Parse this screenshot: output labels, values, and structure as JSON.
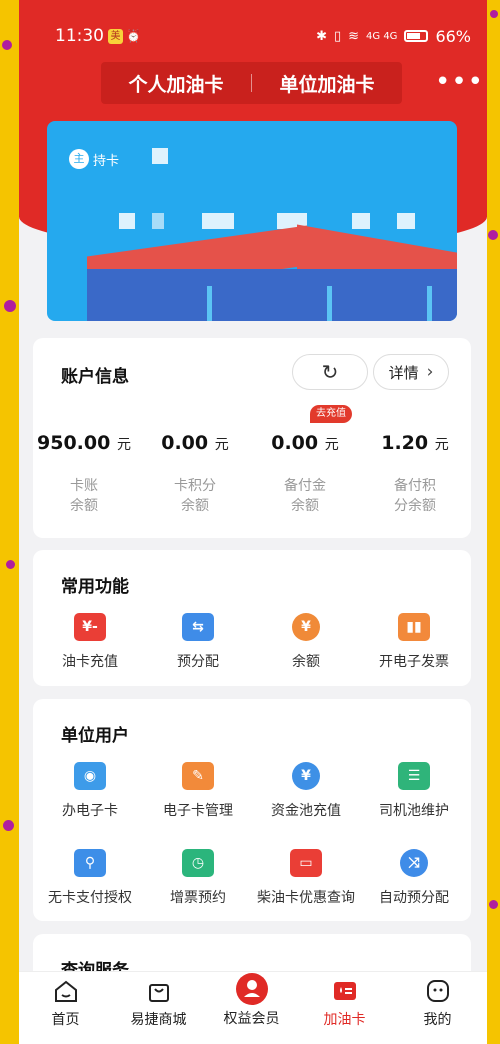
{
  "status": {
    "time": "11:30",
    "badge": "美",
    "alarm": "⏰",
    "signal": "4G 4G",
    "battery": "66%"
  },
  "tabs": {
    "personal": "个人加油卡",
    "company": "单位加油卡",
    "more": "•••"
  },
  "card": {
    "holder_badge": "主",
    "holder_text": "持卡"
  },
  "account": {
    "title": "账户信息",
    "refresh_icon": "refresh-icon",
    "detail_label": "详情",
    "recharge_tag": "去充值",
    "items": [
      {
        "value": "950.00",
        "unit": "元",
        "label1": "卡账",
        "label2": "余额"
      },
      {
        "value": "0.00",
        "unit": "元",
        "label1": "卡积分",
        "label2": "余额"
      },
      {
        "value": "0.00",
        "unit": "元",
        "label1": "备付金",
        "label2": "余额"
      },
      {
        "value": "1.20",
        "unit": "元",
        "label1": "备付积",
        "label2": "分余额"
      }
    ]
  },
  "common": {
    "title": "常用功能",
    "items": [
      {
        "label": "油卡充值",
        "icon": "recharge-icon"
      },
      {
        "label": "预分配",
        "icon": "allocate-icon"
      },
      {
        "label": "余额",
        "icon": "money-bag-icon"
      },
      {
        "label": "开电子发票",
        "icon": "invoice-icon"
      }
    ]
  },
  "company_users": {
    "title": "单位用户",
    "items": [
      {
        "label": "办电子卡",
        "icon": "e-card-icon"
      },
      {
        "label": "电子卡管理",
        "icon": "card-manage-icon"
      },
      {
        "label": "资金池充值",
        "icon": "fund-pool-icon"
      },
      {
        "label": "司机池维护",
        "icon": "driver-pool-icon"
      },
      {
        "label": "无卡支付授权",
        "icon": "cardless-pay-icon"
      },
      {
        "label": "增票预约",
        "icon": "ticket-booking-icon"
      },
      {
        "label": "柴油卡优惠查询",
        "icon": "diesel-discount-icon"
      },
      {
        "label": "自动预分配",
        "icon": "auto-allocate-icon"
      }
    ]
  },
  "query": {
    "title": "查询服务"
  },
  "nav": [
    {
      "label": "首页",
      "icon": "home-icon"
    },
    {
      "label": "易捷商城",
      "icon": "shop-bag-icon"
    },
    {
      "label": "权益会员",
      "icon": "member-icon"
    },
    {
      "label": "加油卡",
      "icon": "fuel-card-icon"
    },
    {
      "label": "我的",
      "icon": "profile-icon"
    }
  ],
  "colors": {
    "brand_red": "#e02a26",
    "card_blue": "#25a9ee",
    "active_nav": "#e02a26"
  }
}
